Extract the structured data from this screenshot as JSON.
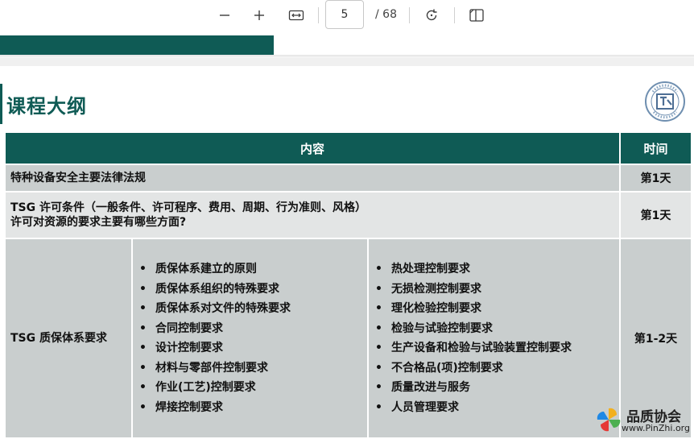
{
  "toolbar": {
    "zoom_out_icon": "minus-icon",
    "zoom_in_icon": "plus-icon",
    "fit_width_icon": "fit-width-icon",
    "page_current": "5",
    "page_total": "/ 68",
    "rotate_icon": "rotate-icon",
    "page_view_icon": "page-view-icon"
  },
  "progress": {
    "fraction": 0.395,
    "color": "#0f5b55"
  },
  "slide": {
    "title": "课程大纲",
    "header": {
      "content": "内容",
      "time": "时间"
    },
    "rows": [
      {
        "content": "特种设备安全主要法律法规",
        "time": "第1天"
      },
      {
        "line1": "TSG 许可条件（一般条件、许可程序、费用、周期、行为准则、风格）",
        "line2": "许可对资源的要求主要有哪些方面?",
        "time": "第1天"
      },
      {
        "content": "TSG 质保体系要求",
        "time": "第1-2天",
        "left_list": [
          "质保体系建立的原则",
          "质保体系组织的特殊要求",
          "质保体系对文件的特殊要求",
          "合同控制要求",
          "设计控制要求",
          "材料与零部件控制要求",
          "作业(工艺)控制要求",
          "焊接控制要求"
        ],
        "right_list": [
          "热处理控制要求",
          "无损检测控制要求",
          "理化检验控制要求",
          "检验与试验控制要求",
          "生产设备和检验与试验装置控制要求",
          "不合格品(项)控制要求",
          "质量改进与服务",
          "人员管理要求"
        ],
        "bullet": "•"
      }
    ]
  },
  "watermark": {
    "name": "品质协会",
    "url": "www.PinZhi.org"
  },
  "colors": {
    "accent": "#0f5b55",
    "row_dark": "#c9cece",
    "row_light": "#e3e5e5"
  }
}
